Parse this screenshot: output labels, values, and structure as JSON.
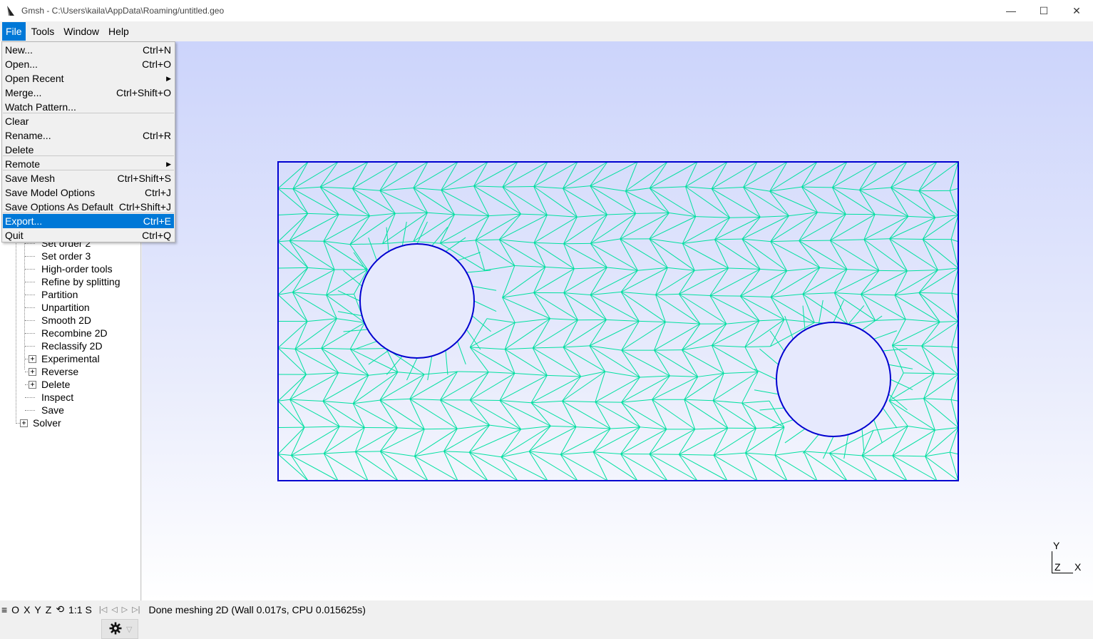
{
  "window": {
    "title": "Gmsh - C:\\Users\\kaila\\AppData\\Roaming/untitled.geo",
    "minimize": "—",
    "maximize": "☐",
    "close": "✕"
  },
  "menubar": {
    "items": [
      "File",
      "Tools",
      "Window",
      "Help"
    ],
    "active": "File"
  },
  "file_menu": {
    "items": [
      {
        "label": "New...",
        "shortcut": "Ctrl+N"
      },
      {
        "label": "Open...",
        "shortcut": "Ctrl+O"
      },
      {
        "label": "Open Recent",
        "shortcut": "",
        "submenu": "▶"
      },
      {
        "label": "Merge...",
        "shortcut": "Ctrl+Shift+O"
      },
      {
        "label": "Watch Pattern...",
        "shortcut": ""
      },
      {
        "label": "Clear",
        "shortcut": ""
      },
      {
        "label": "Rename...",
        "shortcut": "Ctrl+R"
      },
      {
        "label": "Delete",
        "shortcut": ""
      },
      {
        "label": "Remote",
        "shortcut": "",
        "submenu": "▶"
      },
      {
        "label": "Save Mesh",
        "shortcut": "Ctrl+Shift+S"
      },
      {
        "label": "Save Model Options",
        "shortcut": "Ctrl+J"
      },
      {
        "label": "Save Options As Default",
        "shortcut": "Ctrl+Shift+J"
      },
      {
        "label": "Export...",
        "shortcut": "Ctrl+E"
      },
      {
        "label": "Quit",
        "shortcut": "Ctrl+Q"
      }
    ],
    "highlighted": "Export..."
  },
  "tree": {
    "items": [
      {
        "label": "Set order 2",
        "expander": ""
      },
      {
        "label": "Set order 3",
        "expander": ""
      },
      {
        "label": "High-order tools",
        "expander": ""
      },
      {
        "label": "Refine by splitting",
        "expander": ""
      },
      {
        "label": "Partition",
        "expander": ""
      },
      {
        "label": "Unpartition",
        "expander": ""
      },
      {
        "label": "Smooth 2D",
        "expander": ""
      },
      {
        "label": "Recombine 2D",
        "expander": ""
      },
      {
        "label": "Reclassify 2D",
        "expander": ""
      },
      {
        "label": "Experimental",
        "expander": "+"
      },
      {
        "label": "Reverse",
        "expander": "+"
      },
      {
        "label": "Delete",
        "expander": "+"
      },
      {
        "label": "Inspect",
        "expander": ""
      },
      {
        "label": "Save",
        "expander": ""
      }
    ],
    "solver": {
      "label": "Solver",
      "expander": "+"
    }
  },
  "statusbar": {
    "menu_icon": "≡",
    "buttons": [
      "O",
      "X",
      "Y",
      "Z"
    ],
    "rotate_icon": "⟲",
    "scale": "1:1",
    "snap": "S",
    "nav": [
      "|◁",
      "◁",
      "▷",
      "▷|"
    ],
    "message": "Done meshing 2D (Wall 0.017s, CPU 0.015625s)"
  },
  "axes": {
    "y": "Y",
    "z": "Z",
    "x": "X"
  },
  "colors": {
    "accent": "#0078d7",
    "mesh_edges": "#00e0a0",
    "geometry_curves": "#0000d0",
    "background_top": "#ccd4fb",
    "background_bottom": "#ffffff"
  }
}
